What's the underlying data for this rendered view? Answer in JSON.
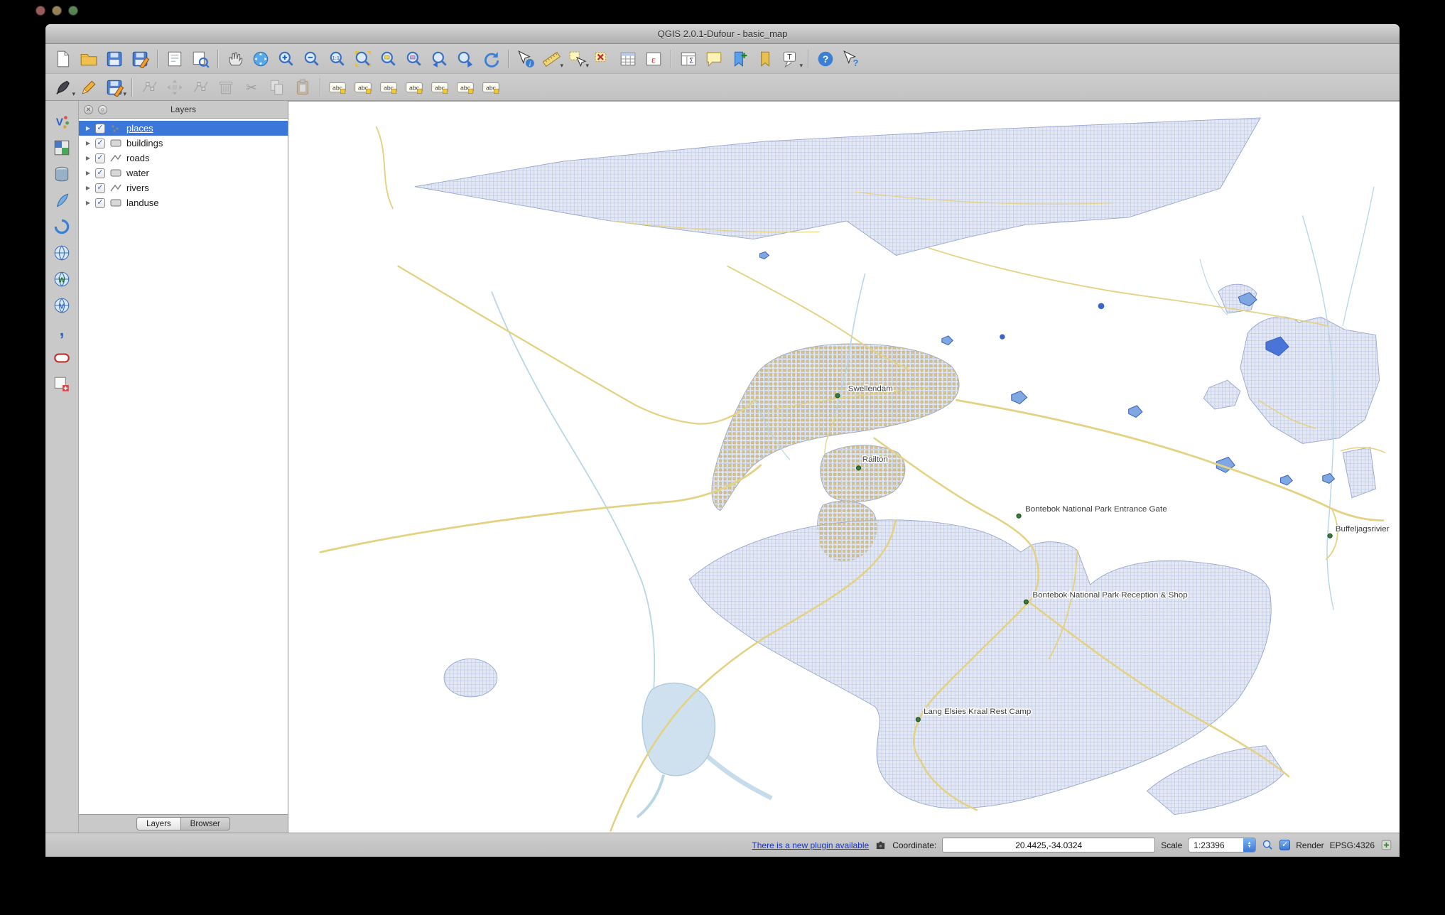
{
  "window": {
    "title": "QGIS 2.0.1-Dufour - basic_map"
  },
  "colors": {
    "selection": "#3b77d8",
    "link": "#1a34c8",
    "landuse": "#dbe2f1",
    "roads": "#e4d282",
    "rivers": "#b7d6e6"
  },
  "toolbar_main": [
    {
      "name": "new-project-button",
      "sym": "sym-page"
    },
    {
      "name": "open-project-button",
      "sym": "sym-folder"
    },
    {
      "name": "save-project-button",
      "sym": "sym-floppy"
    },
    {
      "name": "save-project-as-button",
      "sym": "sym-floppy-pen"
    },
    "|",
    {
      "name": "new-composer-button",
      "sym": "sym-composer"
    },
    {
      "name": "composer-manager-button",
      "sym": "sym-composer-mgr"
    },
    "|",
    {
      "name": "pan-map-button",
      "sym": "sym-hand"
    },
    {
      "name": "pan-to-selection-button",
      "sym": "sym-compass"
    },
    {
      "name": "zoom-in-button",
      "sym": "sym-mag-plus"
    },
    {
      "name": "zoom-out-button",
      "sym": "sym-mag-minus"
    },
    {
      "name": "zoom-native-button",
      "sym": "sym-mag-one"
    },
    {
      "name": "zoom-full-button",
      "sym": "sym-mag-full"
    },
    {
      "name": "zoom-to-selection-button",
      "sym": "sym-mag-sel"
    },
    {
      "name": "zoom-to-layer-button",
      "sym": "sym-mag-layer"
    },
    {
      "name": "zoom-last-button",
      "sym": "sym-mag-last"
    },
    {
      "name": "zoom-next-button",
      "sym": "sym-mag-next"
    },
    {
      "name": "refresh-button",
      "sym": "sym-refresh"
    },
    "|",
    {
      "name": "identify-button",
      "sym": "sym-identify"
    },
    {
      "name": "measure-button",
      "sym": "sym-ruler",
      "dd": true
    },
    {
      "name": "select-features-button",
      "sym": "sym-select",
      "dd": true
    },
    {
      "name": "deselect-features-button",
      "sym": "sym-deselect"
    },
    {
      "name": "attribute-table-button",
      "sym": "sym-table"
    },
    {
      "name": "field-calculator-button",
      "sym": "sym-calc"
    },
    "|",
    {
      "name": "statistical-summary-button",
      "sym": "sym-stats"
    },
    {
      "name": "map-tips-button",
      "sym": "sym-balloon"
    },
    {
      "name": "new-bookmark-button",
      "sym": "sym-bookmark-new"
    },
    {
      "name": "show-bookmarks-button",
      "sym": "sym-bookmark"
    },
    {
      "name": "text-annotation-button",
      "sym": "sym-annot",
      "dd": true
    },
    "|",
    {
      "name": "help-button",
      "sym": "sym-help"
    },
    {
      "name": "whats-this-button",
      "sym": "sym-whatsthis"
    }
  ],
  "toolbar_edit": [
    {
      "name": "current-edits-button",
      "sym": "sym-pen",
      "dd": true
    },
    {
      "name": "toggle-editing-button",
      "sym": "sym-pencil"
    },
    {
      "name": "save-edits-button",
      "sym": "sym-floppy-pen",
      "dd": true
    },
    "|",
    {
      "name": "add-feature-button",
      "sym": "sym-nodes",
      "disabled": true
    },
    {
      "name": "move-feature-button",
      "sym": "sym-move",
      "disabled": true
    },
    {
      "name": "node-tool-button",
      "sym": "sym-nodes",
      "disabled": true
    },
    {
      "name": "delete-selected-button",
      "sym": "sym-trash",
      "disabled": true
    },
    {
      "name": "cut-features-button",
      "sym": "sym-cut",
      "disabled": true
    },
    {
      "name": "copy-features-button",
      "sym": "sym-copy",
      "disabled": true
    },
    {
      "name": "paste-features-button",
      "sym": "sym-paste",
      "disabled": true
    },
    "|",
    {
      "name": "layer-labeling-button",
      "sym": "sym-abc"
    },
    {
      "name": "label-move-button",
      "sym": "sym-abc"
    },
    {
      "name": "label-rotate-button",
      "sym": "sym-abc"
    },
    {
      "name": "label-pin-unpin-button",
      "sym": "sym-abc"
    },
    {
      "name": "label-highlight-button",
      "sym": "sym-abc"
    },
    {
      "name": "label-show-hide-button",
      "sym": "sym-abc"
    },
    {
      "name": "label-properties-button",
      "sym": "sym-abc"
    }
  ],
  "toolbar_left": [
    {
      "name": "add-vector-layer-button",
      "sym": "sym-vector"
    },
    {
      "name": "add-raster-layer-button",
      "sym": "sym-raster"
    },
    {
      "name": "add-postgis-layer-button",
      "sym": "sym-db"
    },
    {
      "name": "add-spatialite-layer-button",
      "sym": "sym-quill"
    },
    {
      "name": "add-mssql-layer-button",
      "sym": "sym-swirl"
    },
    {
      "name": "add-wms-layer-button",
      "sym": "sym-globe"
    },
    {
      "name": "add-wcs-layer-button",
      "sym": "sym-globe2"
    },
    {
      "name": "add-wfs-layer-button",
      "sym": "sym-globe3"
    },
    {
      "name": "add-delimited-text-button",
      "sym": "sym-comma"
    },
    {
      "name": "add-oracle-layer-button",
      "sym": "sym-oracle"
    },
    {
      "name": "new-shapefile-button",
      "sym": "sym-newshp"
    }
  ],
  "layers_panel": {
    "title": "Layers",
    "items": [
      {
        "label": "places",
        "type": "point",
        "checked": true,
        "selected": true
      },
      {
        "label": "buildings",
        "type": "polygon",
        "checked": true
      },
      {
        "label": "roads",
        "type": "line",
        "checked": true
      },
      {
        "label": "water",
        "type": "polygon",
        "checked": true
      },
      {
        "label": "rivers",
        "type": "line",
        "checked": true
      },
      {
        "label": "landuse",
        "type": "polygon",
        "checked": true
      }
    ],
    "tabs": [
      {
        "label": "Layers"
      },
      {
        "label": "Browser"
      }
    ]
  },
  "map": {
    "places": [
      {
        "label": "Swellendam"
      },
      {
        "label": "Railton"
      },
      {
        "label": "Bontebok National Park Entrance Gate"
      },
      {
        "label": "Buffeljagsrivier"
      },
      {
        "label": "Bontebok National Park Reception & Shop"
      },
      {
        "label": "Lang Elsies Kraal Rest Camp"
      }
    ]
  },
  "statusbar": {
    "plugin_link": "There is a new plugin available",
    "coordinate_label": "Coordinate:",
    "coordinate_value": "20.4425,-34.0324",
    "scale_label": "Scale",
    "scale_value": "1:23396",
    "render_label": "Render",
    "crs": "EPSG:4326"
  }
}
